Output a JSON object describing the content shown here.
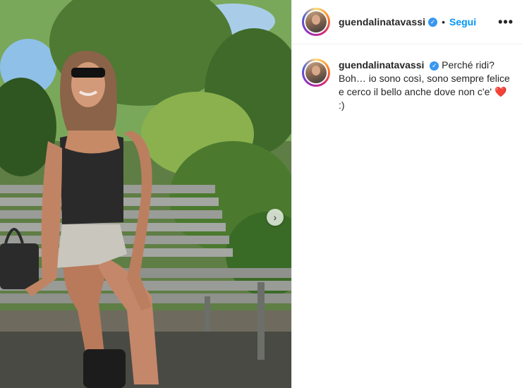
{
  "post": {
    "username": "guendalinatavassi",
    "separator": "•",
    "follow_label": "Segui",
    "more_label": "•••",
    "caption": {
      "line1": "Perché ridi?",
      "line2": "Boh… io sono così, sono sempre felice e cerco il bello anche dove non c'e'",
      "emoji": "❤️",
      "suffix": ":)"
    }
  },
  "media": {
    "next_label": "›"
  }
}
